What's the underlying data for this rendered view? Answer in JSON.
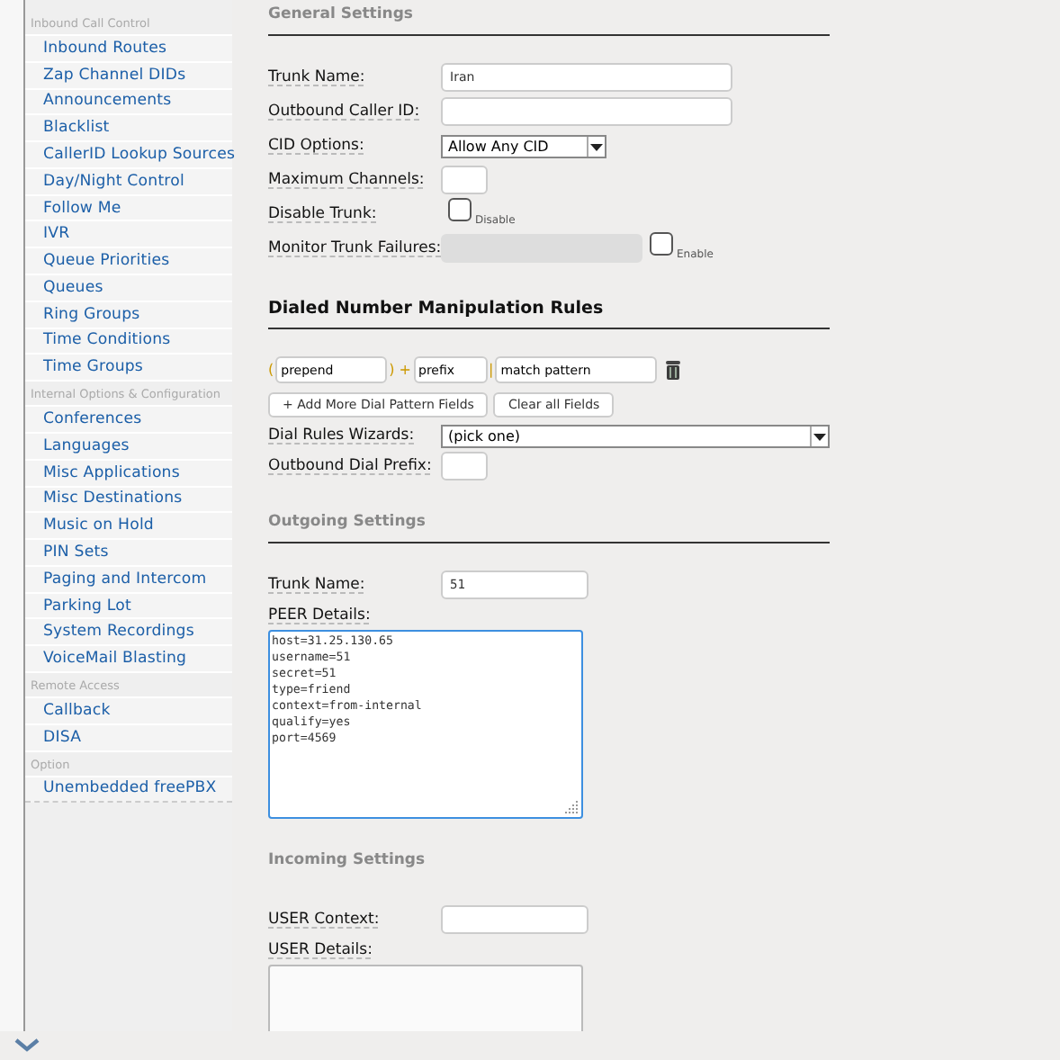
{
  "sidebar": {
    "sections": [
      {
        "title": "Inbound Call Control",
        "items": [
          {
            "label": "Inbound Routes"
          },
          {
            "label": "Zap Channel DIDs"
          },
          {
            "label": "Announcements"
          },
          {
            "label": "Blacklist"
          },
          {
            "label": "CallerID Lookup Sources"
          },
          {
            "label": "Day/Night Control"
          },
          {
            "label": "Follow Me"
          },
          {
            "label": "IVR"
          },
          {
            "label": "Queue Priorities"
          },
          {
            "label": "Queues"
          },
          {
            "label": "Ring Groups"
          },
          {
            "label": "Time Conditions"
          },
          {
            "label": "Time Groups"
          }
        ]
      },
      {
        "title": "Internal Options & Configuration",
        "items": [
          {
            "label": "Conferences"
          },
          {
            "label": "Languages"
          },
          {
            "label": "Misc Applications"
          },
          {
            "label": "Misc Destinations"
          },
          {
            "label": "Music on Hold"
          },
          {
            "label": "PIN Sets"
          },
          {
            "label": "Paging and Intercom"
          },
          {
            "label": "Parking Lot"
          },
          {
            "label": "System Recordings"
          },
          {
            "label": "VoiceMail Blasting"
          }
        ]
      },
      {
        "title": "Remote Access",
        "items": [
          {
            "label": "Callback"
          },
          {
            "label": "DISA"
          }
        ]
      },
      {
        "title": "Option",
        "items": [
          {
            "label": "Unembedded freePBX"
          }
        ]
      }
    ]
  },
  "general": {
    "title": "General Settings",
    "fields": [
      {
        "kind": "text",
        "label": "Trunk Name:",
        "value": "Iran"
      },
      {
        "kind": "text",
        "label": "Outbound Caller ID:"
      },
      {
        "kind": "select",
        "label": "CID Options:",
        "value": "Allow Any CID"
      },
      {
        "kind": "short",
        "label": "Maximum Channels:"
      },
      {
        "kind": "checkbox",
        "label": "Disable Trunk:",
        "caption": "Disable",
        "checked": false
      },
      {
        "kind": "monitor",
        "label": "Monitor Trunk Failures:",
        "disabled": true,
        "caption": "Enable",
        "checked": false
      }
    ]
  },
  "dial_rules": {
    "title": "Dialed Number Manipulation Rules",
    "pattern": [
      {
        "kind": "sep",
        "text": "("
      },
      {
        "kind": "field",
        "value": "prepend"
      },
      {
        "kind": "sep",
        "text": ") +"
      },
      {
        "kind": "field",
        "value": "prefix"
      },
      {
        "kind": "sep",
        "text": "|"
      },
      {
        "kind": "field",
        "value": "match pattern"
      }
    ],
    "buttons": [
      "+ Add More Dial Pattern Fields",
      "Clear all Fields"
    ],
    "fields": [
      {
        "kind": "wide-select",
        "label": "Dial Rules Wizards:",
        "value": "(pick one)"
      },
      {
        "kind": "short",
        "label": "Outbound Dial Prefix:"
      }
    ]
  },
  "outgoing": {
    "title": "Outgoing Settings",
    "fields": [
      {
        "kind": "text",
        "label": "Trunk Name:",
        "value": "51"
      }
    ],
    "details_label": "PEER Details:",
    "details_focused": true,
    "details": [
      "host=31.25.130.65",
      "username=51",
      "secret=51",
      "type=friend",
      "context=from-internal",
      "qualify=yes",
      "port=4569"
    ]
  },
  "incoming": {
    "title": "Incoming Settings",
    "fields": [
      {
        "kind": "text",
        "label": "USER Context:"
      }
    ],
    "details_label": "USER Details:",
    "details_focused": false
  }
}
